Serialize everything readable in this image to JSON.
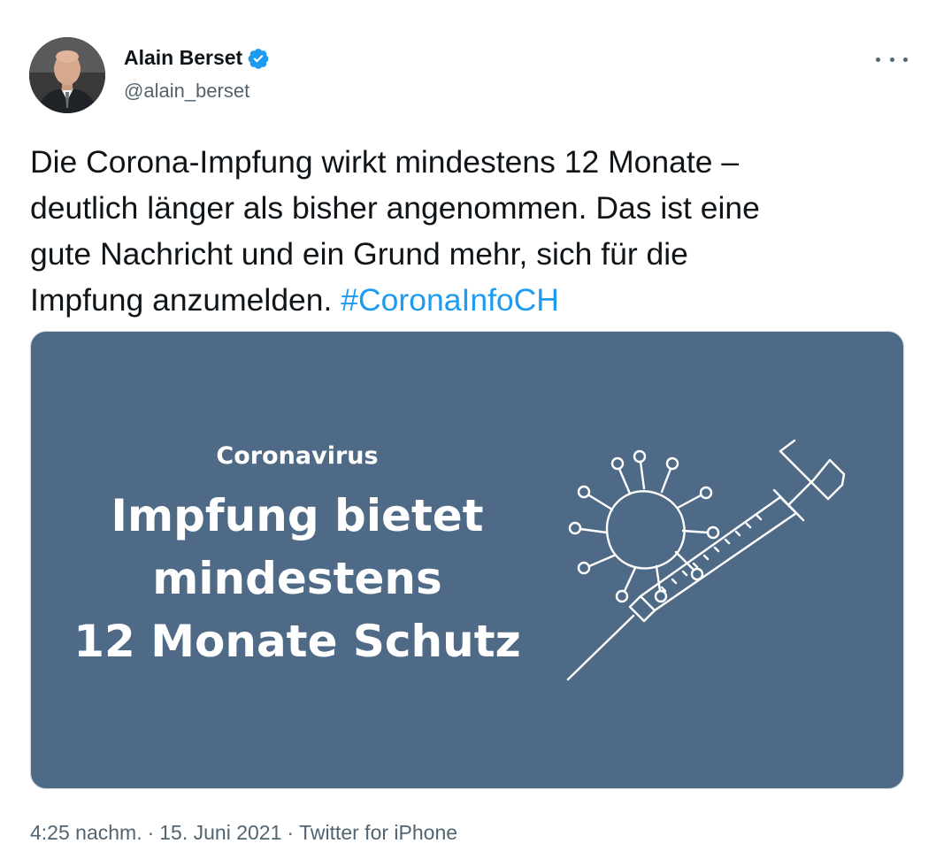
{
  "author": {
    "display_name": "Alain Berset",
    "handle": "@alain_berset",
    "verified": true,
    "avatar_icon": "profile-photo"
  },
  "more_icon": "more-horizontal-icon",
  "tweet": {
    "text_lines": [
      "Die Corona-Impfung wirkt mindestens 12 Monate –",
      "deutlich länger als bisher angenommen. Das ist eine",
      "gute Nachricht und ein Grund mehr, sich für die",
      "Impfung anzumelden. "
    ],
    "hashtag": "#CoronaInfoCH"
  },
  "media": {
    "background_color": "#4f6a86",
    "eyebrow": "Coronavirus",
    "headline_lines": [
      "Impfung bietet",
      "mindestens",
      "12 Monate Schutz"
    ],
    "illustration_icon": "virus-syringe-icon"
  },
  "meta": {
    "time": "4:25 nachm.",
    "separator": "·",
    "date": "15. Juni 2021",
    "source": "Twitter for iPhone"
  },
  "colors": {
    "link": "#1d9bf0",
    "secondary_text": "#536471",
    "verified": "#1d9bf0"
  }
}
